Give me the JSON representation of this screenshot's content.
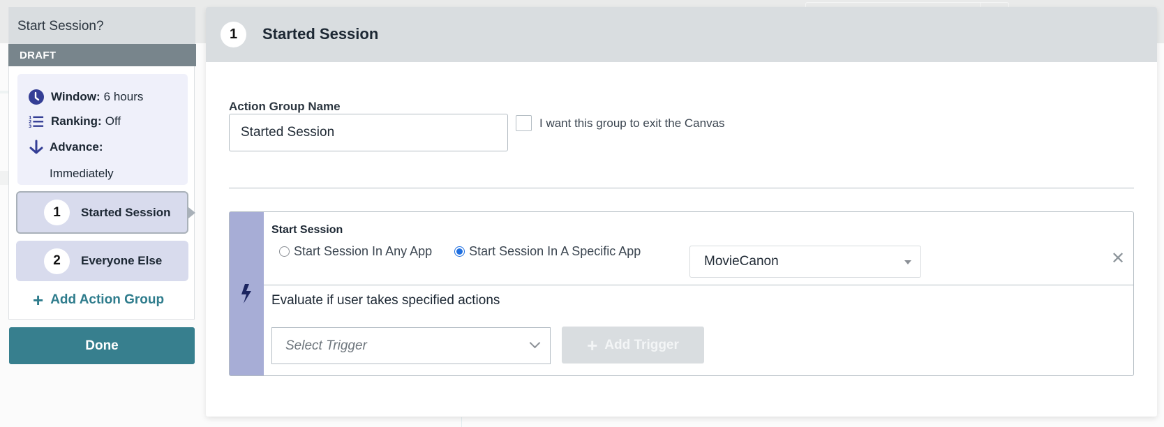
{
  "left_panel": {
    "title": "Start Session?",
    "status_badge": "DRAFT",
    "info": {
      "window_label": "Window:",
      "window_value": "6 hours",
      "ranking_label": "Ranking:",
      "ranking_value": "Off",
      "advance_label": "Advance:",
      "advance_value": "Immediately"
    },
    "action_groups": [
      {
        "number": "1",
        "label": "Started Session",
        "active": true
      },
      {
        "number": "2",
        "label": "Everyone Else",
        "active": false
      }
    ],
    "add_group_label": "Add Action Group",
    "done_label": "Done"
  },
  "main_panel": {
    "header_number": "1",
    "header_title": "Started Session",
    "name_field_label": "Action Group Name",
    "name_field_value": "Started Session",
    "exit_checkbox_label": "I want this group to exit the Canvas",
    "exit_checked": false,
    "trigger": {
      "title": "Start Session",
      "radio_any_label": "Start Session In Any App",
      "radio_specific_label": "Start Session In A Specific App",
      "selected_radio": "specific",
      "app_selected": "MovieCanon",
      "evaluate_text": "Evaluate if user takes specified actions",
      "trigger_placeholder": "Select Trigger",
      "add_trigger_label": "Add Trigger"
    }
  },
  "colors": {
    "accent_teal": "#377f8e",
    "strip_purple": "#a7add6",
    "icon_navy": "#343e95",
    "radio_blue": "#1f6fe0"
  }
}
